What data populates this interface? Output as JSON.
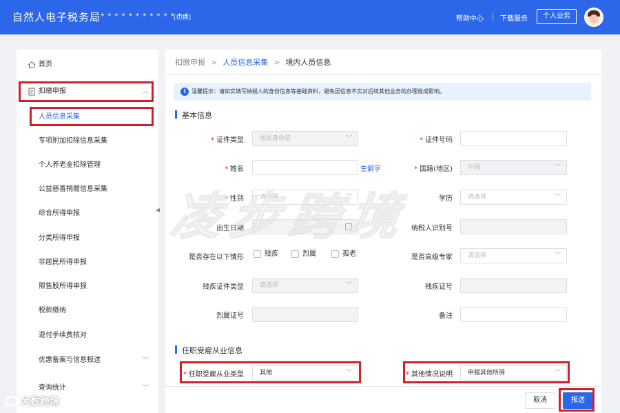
{
  "header": {
    "title": "自然人电子税务局",
    "masked_name": "* * * * * * * * * * * * *",
    "switch_label": "[切换]",
    "help": "帮助中心",
    "download": "下载服务",
    "personal": "个人业务"
  },
  "sidebar": {
    "home": "首页",
    "withholding": "扣缴申报",
    "items": [
      "人员信息采集",
      "专项附加扣除信息采集",
      "个人养老金扣除管理",
      "公益慈善捐赠信息采集",
      "综合所得申报",
      "分类所得申报",
      "非居民所得申报",
      "限售股所得申报",
      "税款缴纳",
      "退付手续费核对",
      "优惠备案与信息报送",
      "查询统计"
    ]
  },
  "breadcrumb": {
    "level1": "扣缴申报",
    "level2": "人员信息采集",
    "level3": "境内人员信息"
  },
  "notice": "温馨提示：请如实填写纳税人的身份信息等基础资料，避免因信息不实对后续其他业务的办理造成影响。",
  "basic": {
    "section": "基本信息",
    "id_type_label": "证件类型",
    "id_type_value": "居民身份证",
    "id_number_label": "证件号码",
    "name_label": "姓名",
    "gen_name": "生僻字",
    "nationality_label": "国籍(地区)",
    "nationality_value": "中国",
    "gender_label": "性别",
    "select_placeholder": "请选择",
    "education_label": "学历",
    "birthdate_label": "出生日期",
    "taxpayer_id_label": "纳税人识别号",
    "situation_label": "是否存在以下情形",
    "opt_disabled": "残疾",
    "opt_martyr": "烈属",
    "opt_elderly": "孤老",
    "expert_label": "是否高级专家",
    "disability_type_label": "残疾证件类型",
    "disability_no_label": "残疾证号",
    "martyr_no_label": "烈属证号",
    "remark_label": "备注"
  },
  "employment": {
    "section": "任职受雇从业信息",
    "type_label": "任职受雇从业类型",
    "type_value": "其他",
    "other_label": "其他情况说明",
    "other_value": "申报其他所得"
  },
  "footer": {
    "cancel": "取消",
    "submit": "报送"
  },
  "watermark": "凌步跨境",
  "brand": "大数跨境",
  "colors": {
    "primary": "#2b67e8",
    "highlight": "#d0202a"
  }
}
